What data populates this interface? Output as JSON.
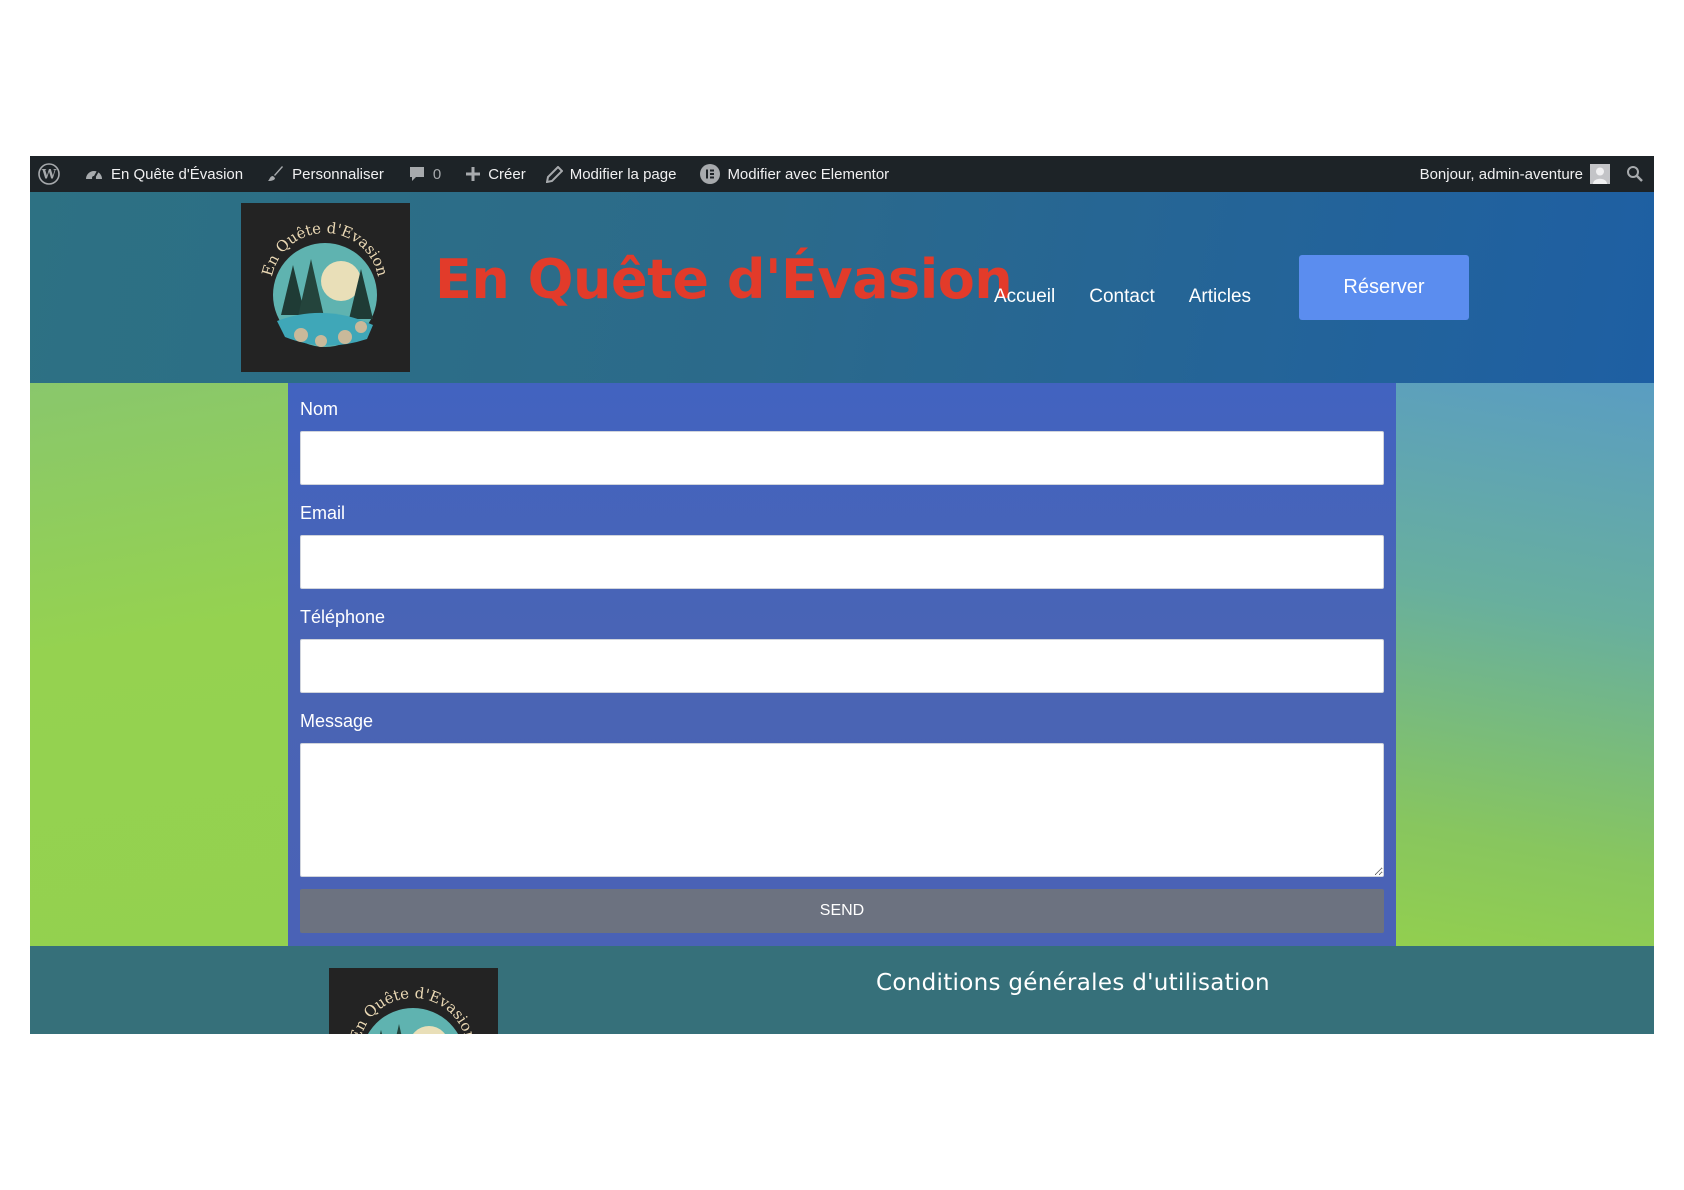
{
  "admin_bar": {
    "site_name": "En Quête d'Évasion",
    "customize_label": "Personnaliser",
    "comments_count": "0",
    "new_label": "Créer",
    "edit_page_label": "Modifier la page",
    "elementor_label": "Modifier avec Elementor",
    "greeting": "Bonjour, admin-aventure"
  },
  "header": {
    "logo_text": "En Quête d'Evasion",
    "site_title": "En Quête d'Évasion",
    "nav": [
      "Accueil",
      "Contact",
      "Articles"
    ],
    "cta_label": "Réserver"
  },
  "form": {
    "fields": [
      {
        "label": "Nom",
        "value": ""
      },
      {
        "label": "Email",
        "value": ""
      },
      {
        "label": "Téléphone",
        "value": ""
      }
    ],
    "message_label": "Message",
    "message_value": "",
    "submit_label": "SEND"
  },
  "footer": {
    "logo_text": "En Quête d'Evasion",
    "terms_link": "Conditions générales d'utilisation"
  },
  "colors": {
    "admin_bar_bg": "#1d2327",
    "header_bg": "#2b6a8b",
    "title_red": "#e23b2a",
    "cta_blue": "#5b8def",
    "form_bg": "#4a64b4",
    "send_bg": "#6c7280",
    "footer_bg": "#36707a"
  }
}
